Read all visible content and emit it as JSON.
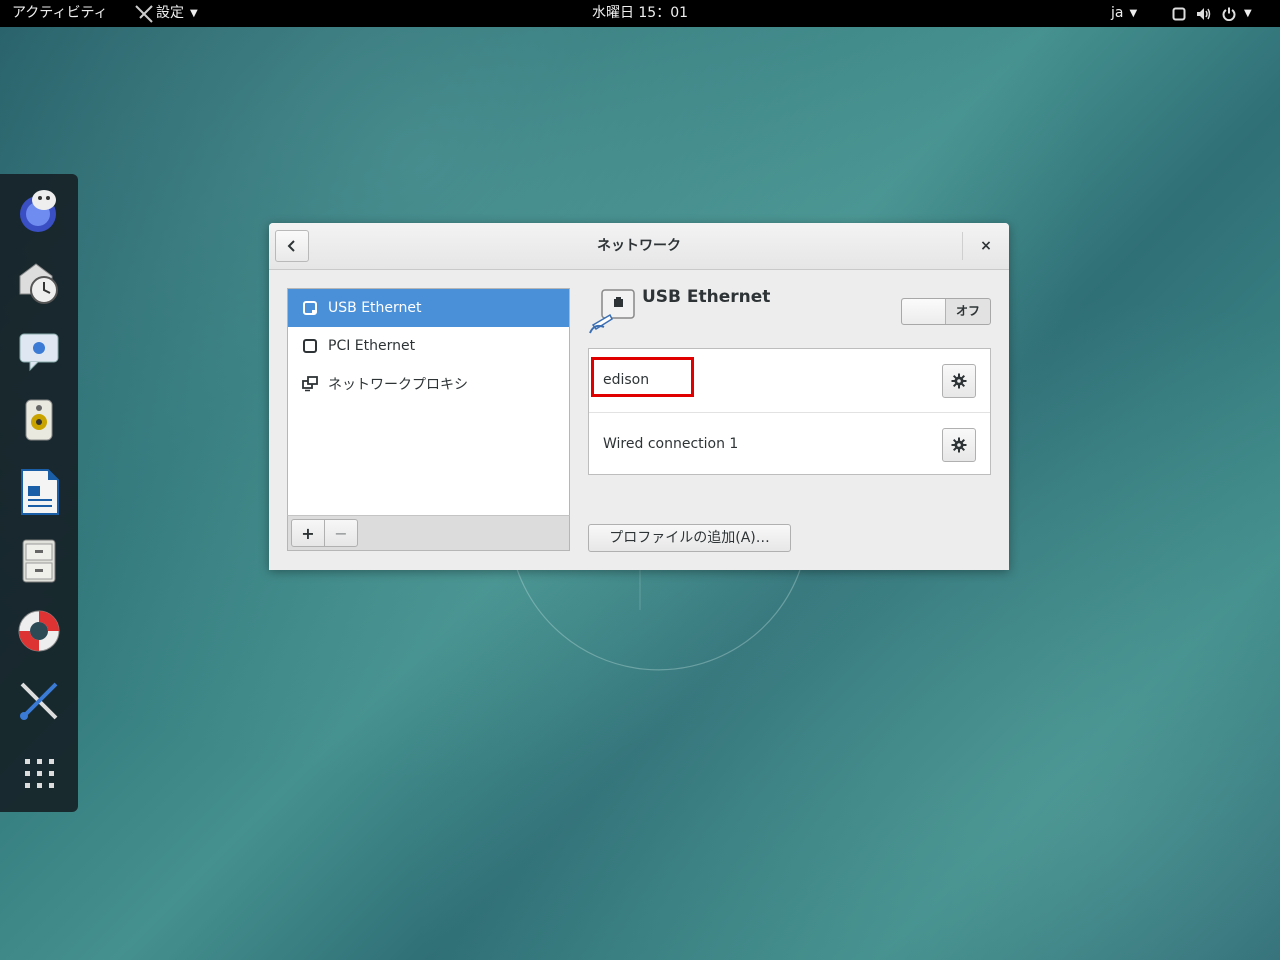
{
  "topbar": {
    "activities": "アクティビティ",
    "app_menu": "設定",
    "clock": "水曜日 15：01",
    "lang": "ja"
  },
  "dash": {
    "apps": [
      "web-browser-icon",
      "mail-clock-icon",
      "chat-icon",
      "music-speaker-icon",
      "writer-document-icon",
      "file-cabinet-icon",
      "help-lifebuoy-icon",
      "settings-tools-icon",
      "show-apps-grid-icon"
    ]
  },
  "window": {
    "title": "ネットワーク",
    "close_glyph": "×"
  },
  "devices": [
    {
      "label": "USB Ethernet",
      "selected": true
    },
    {
      "label": "PCI Ethernet",
      "selected": false
    },
    {
      "label": "ネットワークプロキシ",
      "selected": false
    }
  ],
  "list_toolbar": {
    "add": "+",
    "remove": "−"
  },
  "details": {
    "heading": "USB Ethernet",
    "switch_label": "オフ",
    "profiles": [
      {
        "name": "edison",
        "highlighted": true
      },
      {
        "name": "Wired connection 1",
        "highlighted": false
      }
    ],
    "add_profile": "プロファイルの追加(A)…"
  },
  "colors": {
    "selection": "#4a90d9",
    "highlight": "#e00000",
    "topbar": "#000000"
  }
}
